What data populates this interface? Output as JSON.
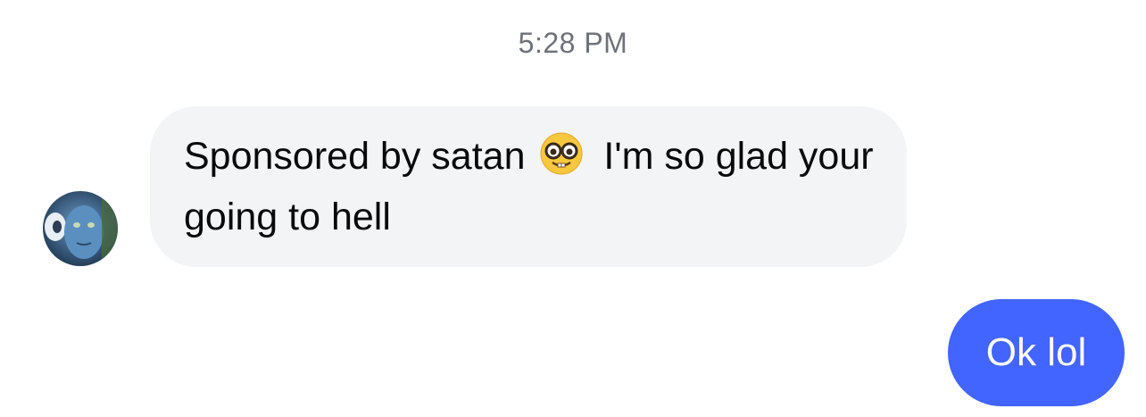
{
  "conversation": {
    "timestamp": "5:28 PM",
    "incoming": {
      "avatar_icon": "avatar-face-photo",
      "text_before_emoji": "Sponsored by satan",
      "emoji": "nerd-face-emoji",
      "text_after_emoji": "I'm so glad your going to hell"
    },
    "outgoing": {
      "text": "Ok lol"
    }
  },
  "colors": {
    "incoming_bubble": "#f3f4f6",
    "outgoing_bubble": "#4264ff",
    "timestamp": "#6e7178"
  }
}
